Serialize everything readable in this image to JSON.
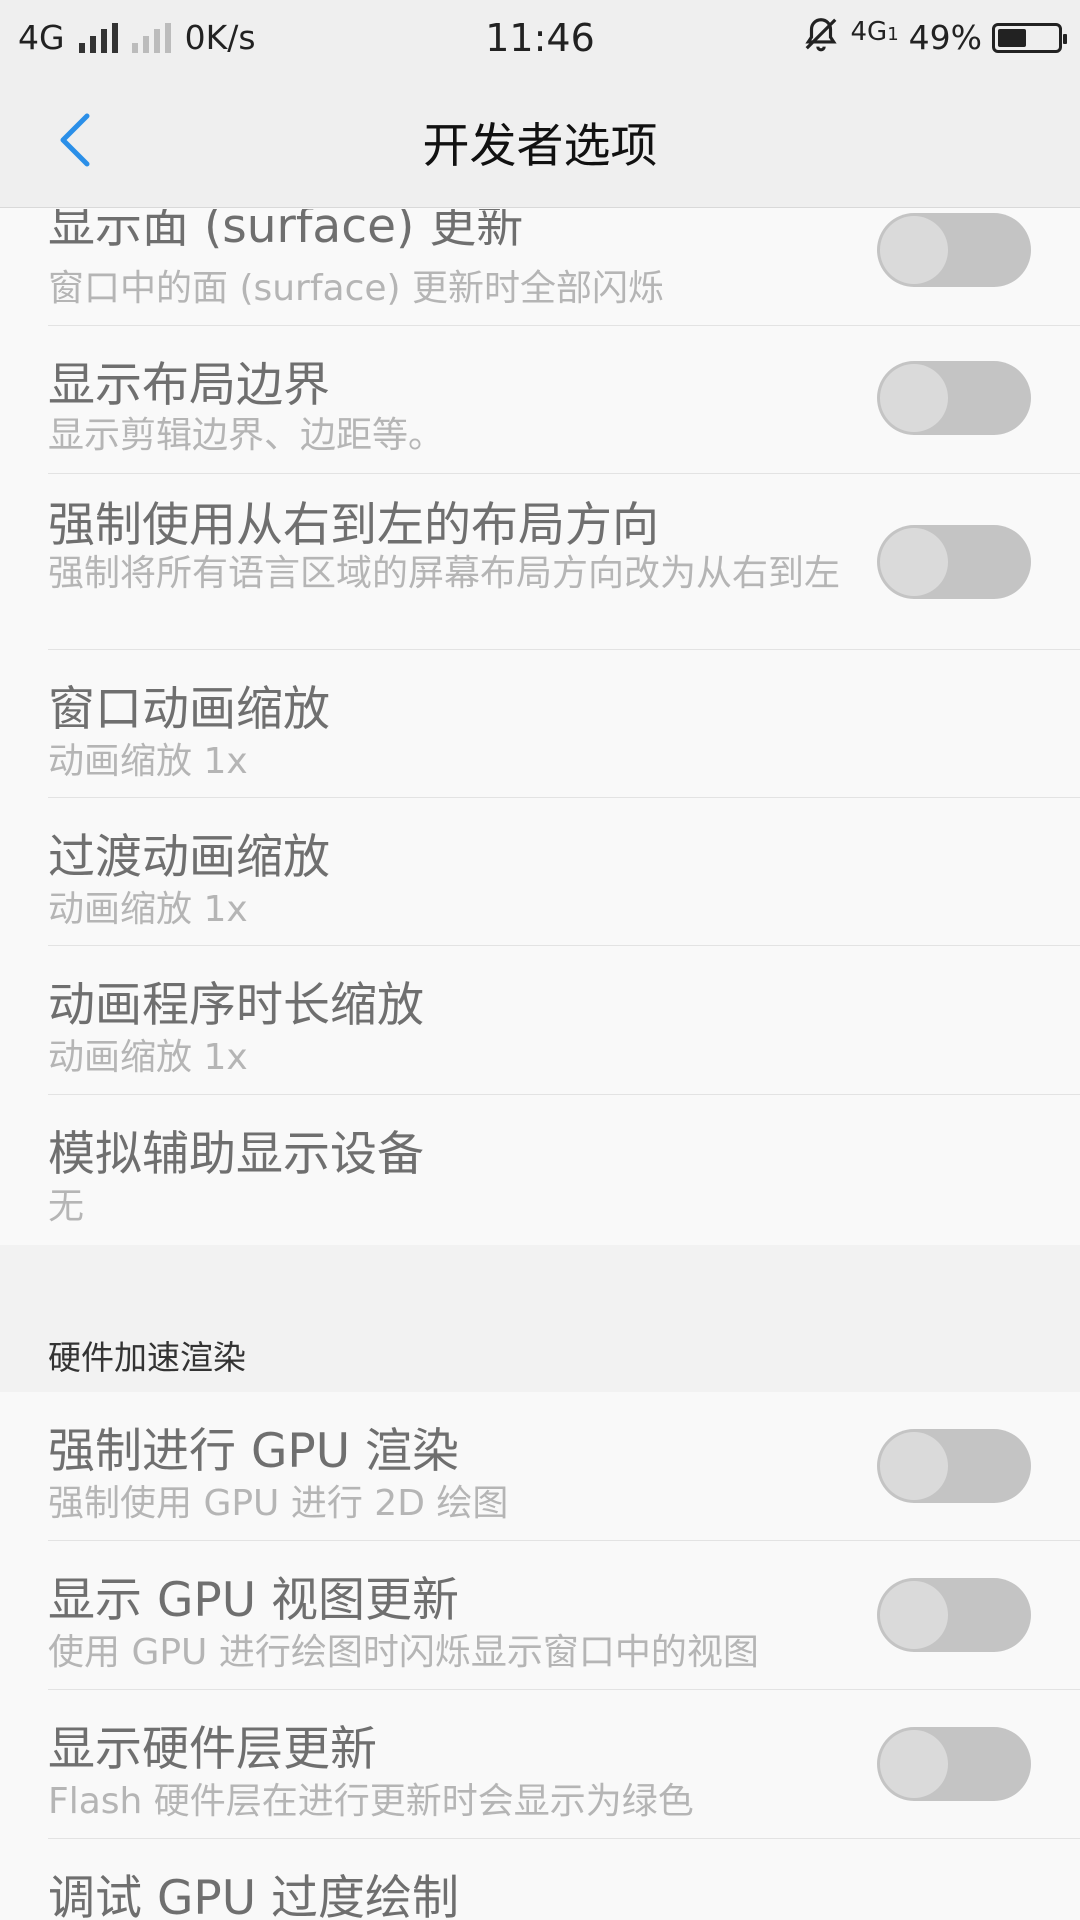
{
  "status_bar": {
    "network": "4G",
    "speed": "0K/s",
    "time": "11:46",
    "network2": "4G",
    "sim_index": "1",
    "battery": "49%",
    "battery_level": 0.49
  },
  "header": {
    "title": "开发者选项"
  },
  "items": [
    {
      "title": "显示面 (surface) 更新",
      "summary": "窗口中的面 (surface) 更新时全部闪烁",
      "toggle": false
    },
    {
      "title": "显示布局边界",
      "summary": "显示剪辑边界、边距等。",
      "toggle": false
    },
    {
      "title": "强制使用从右到左的布局方向",
      "summary": "强制将所有语言区域的屏幕布局方向改为从右到左",
      "toggle": false
    },
    {
      "title": "窗口动画缩放",
      "summary": "动画缩放 1x"
    },
    {
      "title": "过渡动画缩放",
      "summary": "动画缩放 1x"
    },
    {
      "title": "动画程序时长缩放",
      "summary": "动画缩放 1x"
    },
    {
      "title": "模拟辅助显示设备",
      "summary": "无"
    }
  ],
  "section": {
    "title": "硬件加速渲染"
  },
  "hw_items": [
    {
      "title": "强制进行 GPU 渲染",
      "summary": "强制使用 GPU 进行 2D 绘图",
      "toggle": false
    },
    {
      "title": "显示 GPU 视图更新",
      "summary": "使用 GPU 进行绘图时闪烁显示窗口中的视图",
      "toggle": false
    },
    {
      "title": "显示硬件层更新",
      "summary": "Flash 硬件层在进行更新时会显示为绿色",
      "toggle": false
    },
    {
      "title": "调试 GPU 过度绘制",
      "summary": ""
    }
  ]
}
